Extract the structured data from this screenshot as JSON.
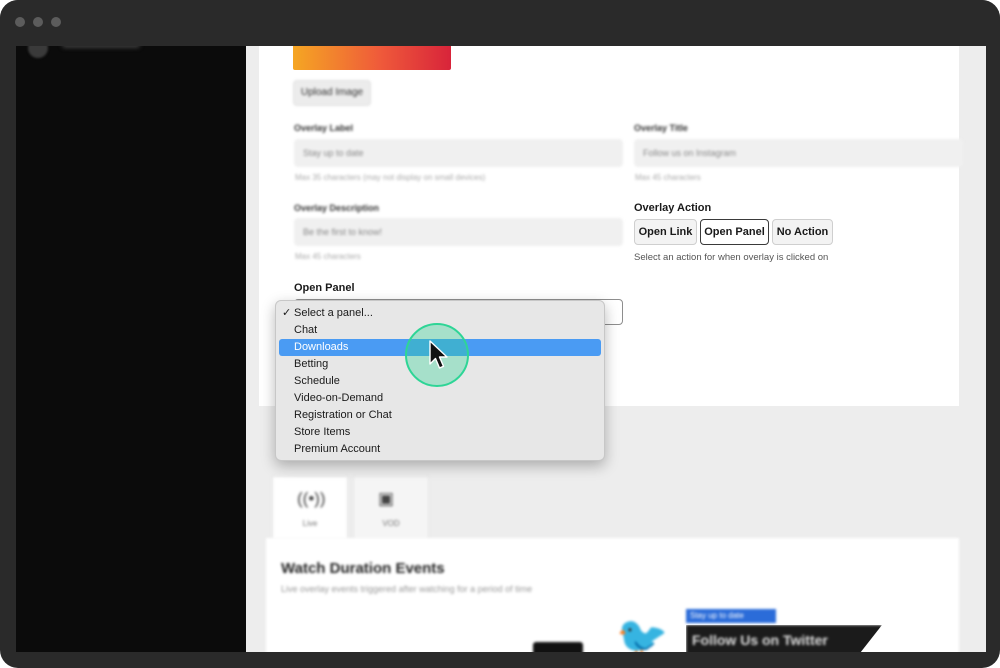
{
  "window": {
    "traffic_lights": [
      "close",
      "minimize",
      "zoom"
    ]
  },
  "sidebar": {
    "user_name": "Username"
  },
  "overlay_form": {
    "upload_button": "Upload Image",
    "overlay_label": {
      "label": "Overlay Label",
      "value": "Stay up to date",
      "hint": "Max 35 characters (may not display on small devices)"
    },
    "overlay_title": {
      "label": "Overlay Title",
      "value": "Follow us on Instagram",
      "hint": "Max 45 characters"
    },
    "overlay_description": {
      "label": "Overlay Description",
      "value": "Be the first to know!",
      "hint": "Max 45 characters"
    },
    "overlay_action": {
      "label": "Overlay Action",
      "options": [
        "Open Link",
        "Open Panel",
        "No Action"
      ],
      "selected": "Open Panel",
      "hint": "Select an action for when overlay is clicked on"
    },
    "open_panel": {
      "label": "Open Panel",
      "options": [
        "Select a panel...",
        "Chat",
        "Downloads",
        "Betting",
        "Schedule",
        "Video-on-Demand",
        "Registration or Chat",
        "Store Items",
        "Premium Account"
      ],
      "checked": "Select a panel...",
      "highlighted": "Downloads"
    }
  },
  "event_tabs": [
    {
      "label": "Live",
      "icon": "broadcast-icon"
    },
    {
      "label": "VOD",
      "icon": "video-icon"
    }
  ],
  "watch_duration": {
    "heading": "Watch Duration Events",
    "description": "Live overlay events triggered after watching for a period of time",
    "preview_tag": "Stay up to date",
    "preview_title": "Follow Us on Twitter"
  },
  "colors": {
    "accent": "#4a9bf3",
    "cursor_ring": "#2ed596",
    "sidebar": "#0b0b0b",
    "twitter": "#1da1f2"
  }
}
